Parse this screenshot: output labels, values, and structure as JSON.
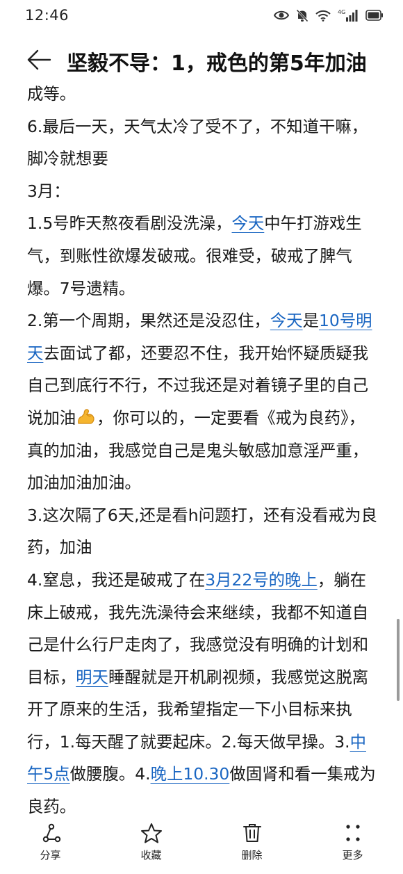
{
  "status_bar": {
    "time": "12:46",
    "network_label": "4G"
  },
  "header": {
    "title": "坚毅不导：1，戒色的第5年加油"
  },
  "article": {
    "cut_line": "成等。",
    "p1": "6.最后一天，天气太冷了受不了，不知道干嘛，脚冷就想要",
    "p2": "3月：",
    "p3": [
      "1.5号昨天熬夜看剧没洗澡，",
      "今天",
      "中午打游戏生气，到账性欲爆发破戒。很难受，破戒了脾气爆。7号遗精。"
    ],
    "p4": [
      "2.第一个周期，果然还是没忍住，",
      "今天",
      "是",
      "10号明天",
      "去面试了都，还要忍不住，我开始怀疑质疑我自己到底行不行，不过我还是对着镜子里的自己说加油",
      "，你可以的，一定要看《戒为良药》，真的加油，我感觉自己是鬼头敏感加意淫严重，加油加油加油。"
    ],
    "p5": "3.这次隔了6天,还是看h问题打，还有没看戒为良药，加油",
    "p6": [
      "4.窒息，我还是破戒了在",
      "3月22号的晚上",
      "，躺在床上破戒，我先洗澡待会来继续，我都不知道自己是什么行尸走肉了，我感觉没有明确的计划和目标，",
      "明天",
      "睡醒就是开机刷视频，我感觉这脱离开了原来的生活，我希望指定一下小目标来执行，1.每天醒了就要起床。2.每天做早操。3.",
      "中午5点",
      "做腰腹。4.",
      "晚上10.30",
      "做固肾和看一集戒为良药。"
    ]
  },
  "bottom_nav": [
    {
      "label": "分享",
      "icon": "share-icon"
    },
    {
      "label": "收藏",
      "icon": "star-icon"
    },
    {
      "label": "删除",
      "icon": "trash-icon"
    },
    {
      "label": "更多",
      "icon": "more-icon"
    }
  ],
  "colors": {
    "link": "#1a66c2",
    "text": "#1a1a1a",
    "background": "#ffffff"
  }
}
